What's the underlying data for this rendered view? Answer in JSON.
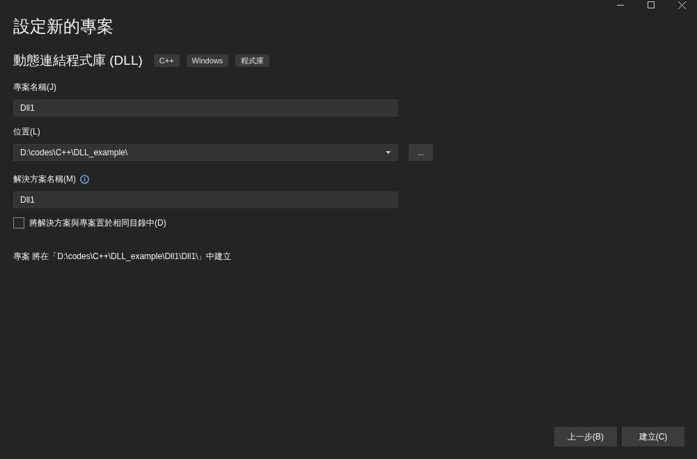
{
  "title": "設定新的專案",
  "template": {
    "name": "動態連結程式庫 (DLL)",
    "tags": [
      "C++",
      "Windows",
      "程式庫"
    ]
  },
  "project_name": {
    "label": "專案名稱(J)",
    "value": "Dll1"
  },
  "location": {
    "label": "位置(L)",
    "value": "D:\\codes\\C++\\DLL_example\\",
    "browse": "..."
  },
  "solution_name": {
    "label": "解決方案名稱(M)",
    "value": "Dll1"
  },
  "same_directory": {
    "label": "將解決方案與專案置於相同目錄中(D)",
    "checked": false
  },
  "summary": "專案 將在「D:\\codes\\C++\\DLL_example\\Dll1\\Dll1\\」中建立",
  "buttons": [
    {
      "label": "上一步(B)"
    },
    {
      "label": "建立(C)"
    }
  ]
}
